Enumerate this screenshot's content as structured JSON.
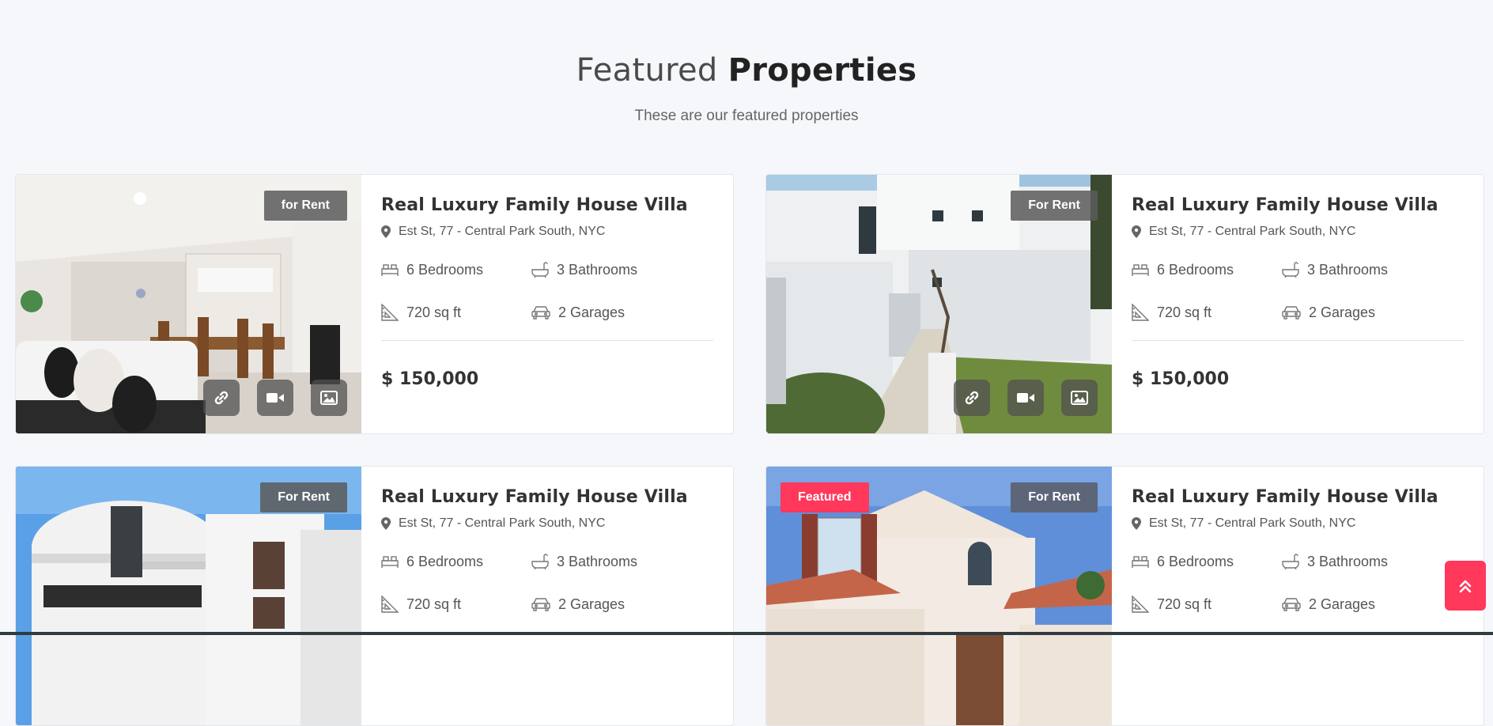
{
  "section": {
    "title_light": "Featured",
    "title_bold": "Properties",
    "subtitle": "These are our featured properties"
  },
  "cards": [
    {
      "title": "Real Luxury Family House Villa",
      "address": "Est St, 77 - Central Park South, NYC",
      "badge": "for Rent",
      "bedrooms": "6 Bedrooms",
      "bathrooms": "3 Bathrooms",
      "area": "720 sq ft",
      "garages": "2 Garages",
      "price": "$ 150,000"
    },
    {
      "title": "Real Luxury Family House Villa",
      "address": "Est St, 77 - Central Park South, NYC",
      "badge": "For Rent",
      "bedrooms": "6 Bedrooms",
      "bathrooms": "3 Bathrooms",
      "area": "720 sq ft",
      "garages": "2 Garages",
      "price": "$ 150,000"
    },
    {
      "title": "Real Luxury Family House Villa",
      "address": "Est St, 77 - Central Park South, NYC",
      "badge": "For Rent",
      "bedrooms": "6 Bedrooms",
      "bathrooms": "3 Bathrooms",
      "area": "720 sq ft",
      "garages": "2 Garages"
    },
    {
      "title": "Real Luxury Family House Villa",
      "address": "Est St, 77 - Central Park South, NYC",
      "badge": "For Rent",
      "featured_badge": "Featured",
      "bedrooms": "6 Bedrooms",
      "bathrooms": "3 Bathrooms",
      "area": "720 sq ft",
      "garages": "2 Garages"
    }
  ],
  "icons": {
    "location": "map-pin-icon",
    "bed": "bed-icon",
    "bath": "bathtub-icon",
    "area": "ruler-triangle-icon",
    "garage": "car-icon",
    "link": "link-icon",
    "video": "video-icon",
    "gallery": "image-icon",
    "scroll_top": "double-chevron-up-icon"
  },
  "colors": {
    "accent": "#ff385c",
    "badge_dark": "#5a5a5a",
    "badge_slate": "#5d6579",
    "page_bg": "#f5f7fa"
  }
}
